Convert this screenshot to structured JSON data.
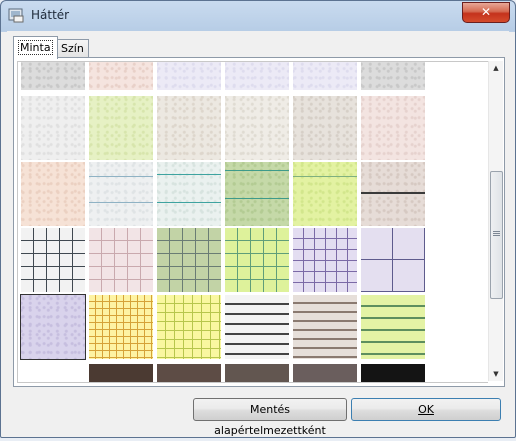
{
  "window": {
    "title": "Háttér"
  },
  "tabs": [
    {
      "label": "Minta",
      "active": true
    },
    {
      "label": "Szín",
      "active": false
    }
  ],
  "buttons": {
    "save_default": "Mentés alapértelmezettként",
    "ok": "OK"
  },
  "patterns": [
    [
      "speckle-grey",
      "speckle-peach",
      "plain-lavender",
      "plain-lavender",
      "plain-lavender",
      "speckle-grey"
    ],
    [
      "paper-light-grey",
      "paper-lime",
      "paper-beige",
      "paper-cream",
      "paper-taupe",
      "paper-pink"
    ],
    [
      "paper-peach",
      "lines-grey-blue",
      "lines-teal",
      "lines-green",
      "lines-lime",
      "lines-dark"
    ],
    [
      "grid-grey-dark",
      "grid-pink",
      "grid-sage",
      "grid-lime",
      "grid-lilac",
      "grid-purple-large"
    ],
    [
      "paper-lilac",
      "grid-yellow-orange",
      "grid-yellow",
      "lines-black-wide",
      "lines-taupe-wide",
      "lines-lime-wide"
    ],
    [
      "blank",
      "solid-dark-brown",
      "solid-brown",
      "solid-grey-brown",
      "solid-mauve",
      "solid-black"
    ]
  ],
  "selected_pattern": "paper-lilac",
  "accent_color": "#3c7fb1"
}
